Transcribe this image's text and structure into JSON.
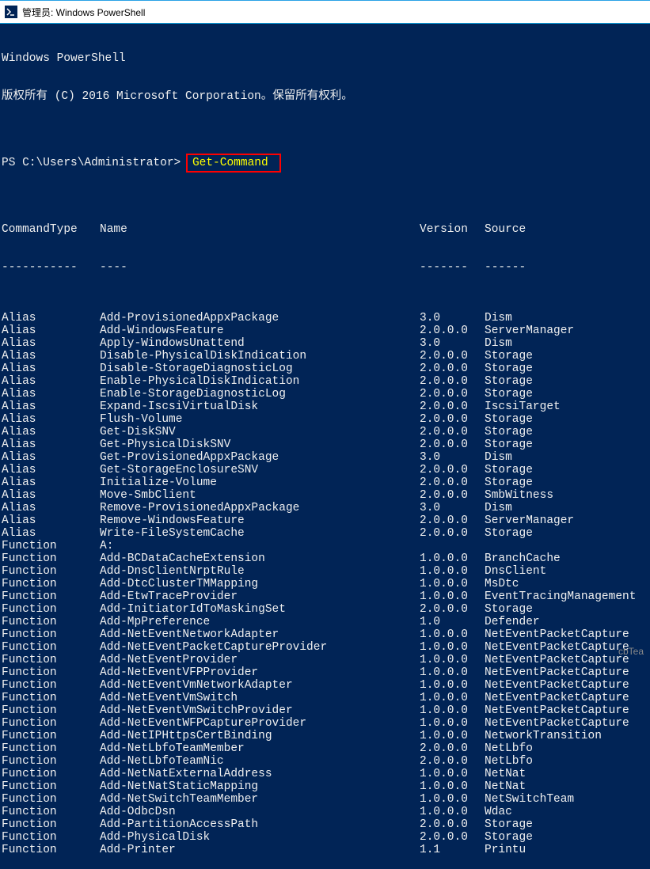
{
  "window": {
    "title": "管理员: Windows PowerShell"
  },
  "intro": {
    "line1": "Windows PowerShell",
    "line2": "版权所有 (C) 2016 Microsoft Corporation。保留所有权利。"
  },
  "prompt": {
    "text": "PS C:\\Users\\Administrator> ",
    "command": "Get-Command"
  },
  "headers": {
    "type": "CommandType",
    "type_ul": "-----------",
    "name": "Name",
    "name_ul": "----",
    "version": "Version",
    "version_ul": "-------",
    "source": "Source",
    "source_ul": "------"
  },
  "rows": [
    {
      "type": "Alias",
      "name": "Add-ProvisionedAppxPackage",
      "version": "3.0",
      "source": "Dism"
    },
    {
      "type": "Alias",
      "name": "Add-WindowsFeature",
      "version": "2.0.0.0",
      "source": "ServerManager"
    },
    {
      "type": "Alias",
      "name": "Apply-WindowsUnattend",
      "version": "3.0",
      "source": "Dism"
    },
    {
      "type": "Alias",
      "name": "Disable-PhysicalDiskIndication",
      "version": "2.0.0.0",
      "source": "Storage"
    },
    {
      "type": "Alias",
      "name": "Disable-StorageDiagnosticLog",
      "version": "2.0.0.0",
      "source": "Storage"
    },
    {
      "type": "Alias",
      "name": "Enable-PhysicalDiskIndication",
      "version": "2.0.0.0",
      "source": "Storage"
    },
    {
      "type": "Alias",
      "name": "Enable-StorageDiagnosticLog",
      "version": "2.0.0.0",
      "source": "Storage"
    },
    {
      "type": "Alias",
      "name": "Expand-IscsiVirtualDisk",
      "version": "2.0.0.0",
      "source": "IscsiTarget"
    },
    {
      "type": "Alias",
      "name": "Flush-Volume",
      "version": "2.0.0.0",
      "source": "Storage"
    },
    {
      "type": "Alias",
      "name": "Get-DiskSNV",
      "version": "2.0.0.0",
      "source": "Storage"
    },
    {
      "type": "Alias",
      "name": "Get-PhysicalDiskSNV",
      "version": "2.0.0.0",
      "source": "Storage"
    },
    {
      "type": "Alias",
      "name": "Get-ProvisionedAppxPackage",
      "version": "3.0",
      "source": "Dism"
    },
    {
      "type": "Alias",
      "name": "Get-StorageEnclosureSNV",
      "version": "2.0.0.0",
      "source": "Storage"
    },
    {
      "type": "Alias",
      "name": "Initialize-Volume",
      "version": "2.0.0.0",
      "source": "Storage"
    },
    {
      "type": "Alias",
      "name": "Move-SmbClient",
      "version": "2.0.0.0",
      "source": "SmbWitness"
    },
    {
      "type": "Alias",
      "name": "Remove-ProvisionedAppxPackage",
      "version": "3.0",
      "source": "Dism"
    },
    {
      "type": "Alias",
      "name": "Remove-WindowsFeature",
      "version": "2.0.0.0",
      "source": "ServerManager"
    },
    {
      "type": "Alias",
      "name": "Write-FileSystemCache",
      "version": "2.0.0.0",
      "source": "Storage"
    },
    {
      "type": "Function",
      "name": "A:",
      "version": "",
      "source": ""
    },
    {
      "type": "Function",
      "name": "Add-BCDataCacheExtension",
      "version": "1.0.0.0",
      "source": "BranchCache"
    },
    {
      "type": "Function",
      "name": "Add-DnsClientNrptRule",
      "version": "1.0.0.0",
      "source": "DnsClient"
    },
    {
      "type": "Function",
      "name": "Add-DtcClusterTMMapping",
      "version": "1.0.0.0",
      "source": "MsDtc"
    },
    {
      "type": "Function",
      "name": "Add-EtwTraceProvider",
      "version": "1.0.0.0",
      "source": "EventTracingManagement"
    },
    {
      "type": "Function",
      "name": "Add-InitiatorIdToMaskingSet",
      "version": "2.0.0.0",
      "source": "Storage"
    },
    {
      "type": "Function",
      "name": "Add-MpPreference",
      "version": "1.0",
      "source": "Defender"
    },
    {
      "type": "Function",
      "name": "Add-NetEventNetworkAdapter",
      "version": "1.0.0.0",
      "source": "NetEventPacketCapture"
    },
    {
      "type": "Function",
      "name": "Add-NetEventPacketCaptureProvider",
      "version": "1.0.0.0",
      "source": "NetEventPacketCapture"
    },
    {
      "type": "Function",
      "name": "Add-NetEventProvider",
      "version": "1.0.0.0",
      "source": "NetEventPacketCapture"
    },
    {
      "type": "Function",
      "name": "Add-NetEventVFPProvider",
      "version": "1.0.0.0",
      "source": "NetEventPacketCapture"
    },
    {
      "type": "Function",
      "name": "Add-NetEventVmNetworkAdapter",
      "version": "1.0.0.0",
      "source": "NetEventPacketCapture"
    },
    {
      "type": "Function",
      "name": "Add-NetEventVmSwitch",
      "version": "1.0.0.0",
      "source": "NetEventPacketCapture"
    },
    {
      "type": "Function",
      "name": "Add-NetEventVmSwitchProvider",
      "version": "1.0.0.0",
      "source": "NetEventPacketCapture"
    },
    {
      "type": "Function",
      "name": "Add-NetEventWFPCaptureProvider",
      "version": "1.0.0.0",
      "source": "NetEventPacketCapture"
    },
    {
      "type": "Function",
      "name": "Add-NetIPHttpsCertBinding",
      "version": "1.0.0.0",
      "source": "NetworkTransition"
    },
    {
      "type": "Function",
      "name": "Add-NetLbfoTeamMember",
      "version": "2.0.0.0",
      "source": "NetLbfo"
    },
    {
      "type": "Function",
      "name": "Add-NetLbfoTeamNic",
      "version": "2.0.0.0",
      "source": "NetLbfo"
    },
    {
      "type": "Function",
      "name": "Add-NetNatExternalAddress",
      "version": "1.0.0.0",
      "source": "NetNat"
    },
    {
      "type": "Function",
      "name": "Add-NetNatStaticMapping",
      "version": "1.0.0.0",
      "source": "NetNat"
    },
    {
      "type": "Function",
      "name": "Add-NetSwitchTeamMember",
      "version": "1.0.0.0",
      "source": "NetSwitchTeam"
    },
    {
      "type": "Function",
      "name": "Add-OdbcDsn",
      "version": "1.0.0.0",
      "source": "Wdac"
    },
    {
      "type": "Function",
      "name": "Add-PartitionAccessPath",
      "version": "2.0.0.0",
      "source": "Storage"
    },
    {
      "type": "Function",
      "name": "Add-PhysicalDisk",
      "version": "2.0.0.0",
      "source": "Storage"
    },
    {
      "type": "Function",
      "name": "Add-Printer",
      "version": "1.1",
      "source": "Printu"
    }
  ],
  "footer_note": "cbTea"
}
